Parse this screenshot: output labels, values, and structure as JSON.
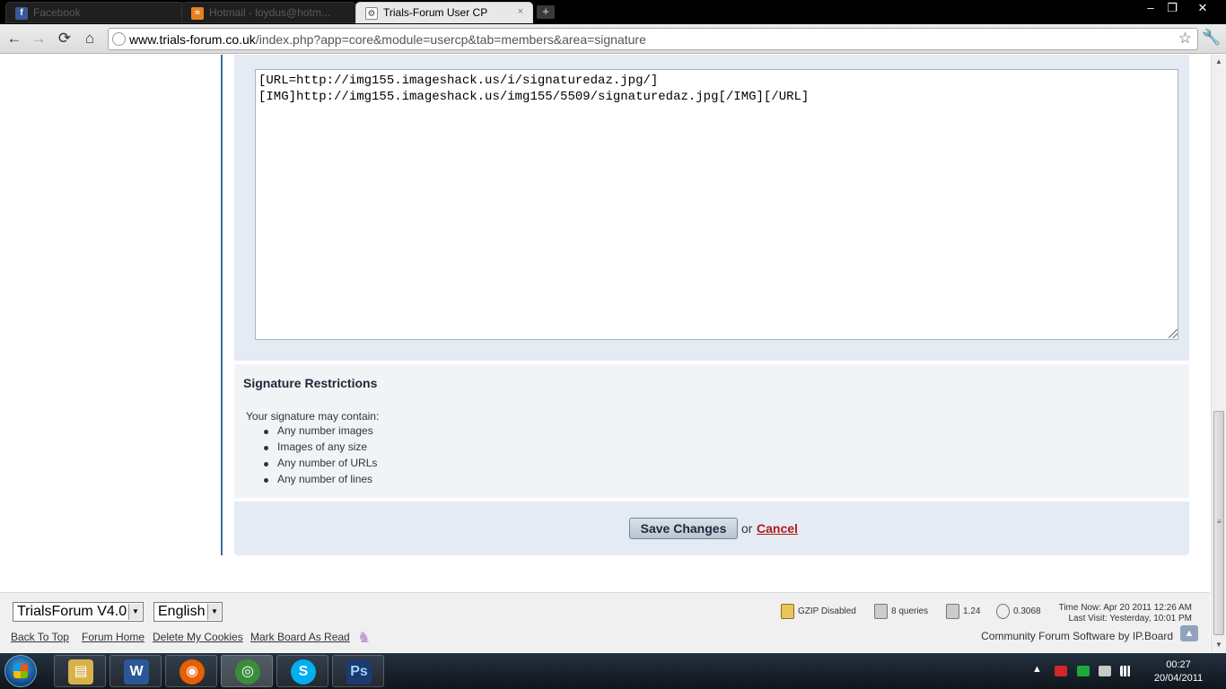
{
  "browser": {
    "tabs": [
      {
        "label": "Facebook",
        "favicon_letter": "f",
        "favicon_color": "#3b5998",
        "active": false
      },
      {
        "label": "Hotmail - loydus@hotm...",
        "favicon_letter": "≈",
        "favicon_color": "#e87f1e",
        "active": false
      },
      {
        "label": "Trials-Forum User CP",
        "favicon_letter": "⚙",
        "favicon_color": "#444444",
        "active": true
      }
    ],
    "tab_close_glyph": "×",
    "newtab_glyph": "+",
    "window_buttons": {
      "minimize": "–",
      "restore": "❐",
      "close": "✕"
    },
    "url_host": "www.trials-forum.co.uk",
    "url_path": "/index.php?app=core&module=usercp&tab=members&area=signature",
    "nav_glyphs": {
      "back": "←",
      "forward": "→",
      "reload": "⟳",
      "home": "⌂",
      "star": "☆",
      "wrench": "🔧"
    }
  },
  "signature": {
    "content": "[URL=http://img155.imageshack.us/i/signaturedaz.jpg/]\n[IMG]http://img155.imageshack.us/img155/5509/signaturedaz.jpg[/IMG][/URL]"
  },
  "restrictions": {
    "title": "Signature Restrictions",
    "intro": "Your signature may contain:",
    "items": [
      "Any number images",
      "Images of any size",
      "Any number of URLs",
      "Any number of lines"
    ]
  },
  "actions": {
    "save_label": "Save Changes",
    "or_text": "or",
    "cancel_label": "Cancel"
  },
  "footer": {
    "skin_selected": "TrialsForum V4.0",
    "language_selected": "English",
    "caret": "▼",
    "links": [
      "Back To Top",
      "Forum Home",
      "Delete My Cookies",
      "Mark Board As Read"
    ],
    "stats": {
      "gzip": "GZIP Disabled",
      "queries": "8 queries",
      "load": "1.24",
      "time": "0.3068"
    },
    "time_now": "Time Now: Apr 20 2011 12:26 AM",
    "last_visit": "Last Visit: Yesterday, 10:01 PM",
    "powered_by": "Community Forum Software by IP.Board",
    "to_top_glyph": "▲"
  },
  "taskbar": {
    "apps": [
      {
        "name": "explorer",
        "glyph": "▤",
        "color": "#d8b14a",
        "active": false
      },
      {
        "name": "word",
        "glyph": "W",
        "color": "#2b5797",
        "active": false
      },
      {
        "name": "firefox",
        "glyph": "◉",
        "color": "#e66000",
        "active": false
      },
      {
        "name": "chrome",
        "glyph": "◎",
        "color": "#3b8d3b",
        "active": true
      },
      {
        "name": "skype",
        "glyph": "S",
        "color": "#00aff0",
        "active": false
      },
      {
        "name": "photoshop",
        "glyph": "Ps",
        "color": "#1c3a6e",
        "active": false
      }
    ],
    "tray_arrow": "▲",
    "time": "00:27",
    "date": "20/04/2011"
  }
}
